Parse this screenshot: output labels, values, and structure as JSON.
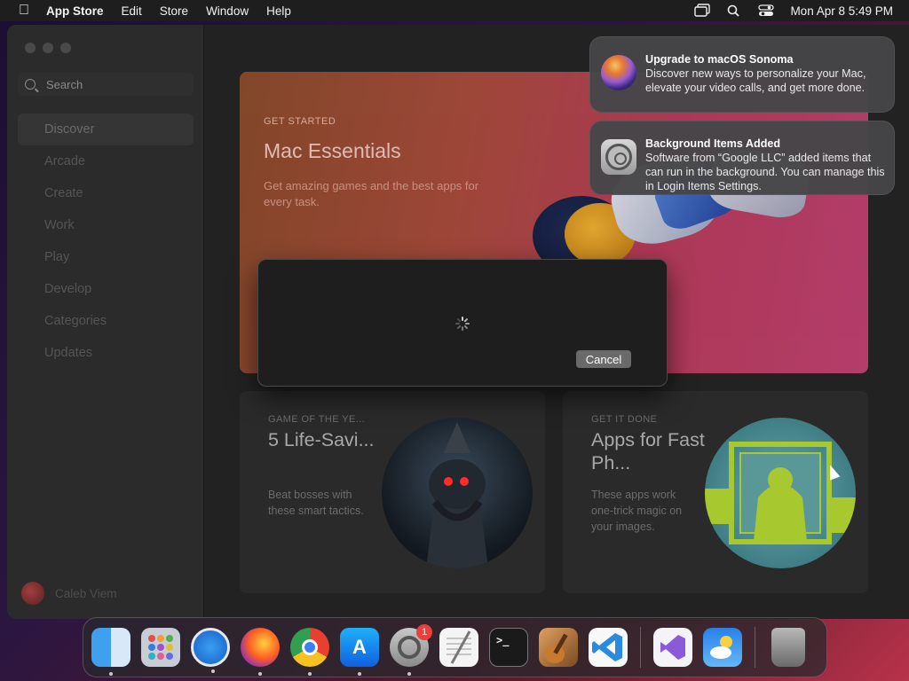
{
  "menubar": {
    "app_name": "App Store",
    "menus": [
      "Edit",
      "Store",
      "Window",
      "Help"
    ],
    "datetime": "Mon Apr 8  5:49 PM"
  },
  "sidebar": {
    "search_placeholder": "Search",
    "items": [
      {
        "label": "Discover",
        "active": true
      },
      {
        "label": "Arcade"
      },
      {
        "label": "Create"
      },
      {
        "label": "Work"
      },
      {
        "label": "Play"
      },
      {
        "label": "Develop"
      },
      {
        "label": "Categories"
      },
      {
        "label": "Updates"
      }
    ],
    "user_name": "Caleb Viem"
  },
  "hero": {
    "eyebrow": "GET STARTED",
    "title": "Mac Essentials",
    "description": "Get amazing games and the best apps for every task."
  },
  "cards": [
    {
      "eyebrow": "GAME OF THE YE...",
      "title": "5 Life-Savi...",
      "description": "Beat bosses with these smart tactics."
    },
    {
      "eyebrow": "GET IT DONE",
      "title": "Apps for Fast Ph...",
      "description": "These apps work one-trick magic on your images."
    }
  ],
  "modal": {
    "cancel_label": "Cancel"
  },
  "notifications": [
    {
      "title": "Upgrade to macOS Sonoma",
      "body": "Discover new ways to personalize your Mac, elevate your video calls, and get more done."
    },
    {
      "title": "Background Items Added",
      "body": "Software from “Google LLC” added items that can run in the background. You can manage this in Login Items Settings."
    }
  ],
  "dock": {
    "apps": [
      {
        "name": "finder-icon",
        "running": true
      },
      {
        "name": "launchpad-icon",
        "running": false
      },
      {
        "name": "safari-icon",
        "running": true
      },
      {
        "name": "firefox-icon",
        "running": true
      },
      {
        "name": "chrome-icon",
        "running": true
      },
      {
        "name": "app-store-icon",
        "running": true
      },
      {
        "name": "system-settings-icon",
        "running": true,
        "badge": "1"
      },
      {
        "name": "textedit-icon",
        "running": false
      },
      {
        "name": "terminal-icon",
        "running": false
      },
      {
        "name": "garageband-icon",
        "running": false
      },
      {
        "name": "vscode-icon",
        "running": false
      }
    ]
  },
  "colors": {
    "accent": "#1a7cf0",
    "badge": "#e8403a",
    "hero_gradient_start": "#8a4a2a",
    "hero_gradient_end": "#c04070"
  }
}
